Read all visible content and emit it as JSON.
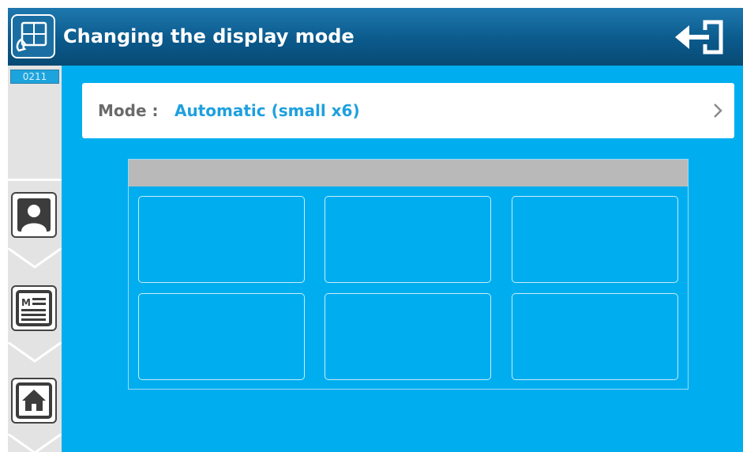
{
  "header": {
    "title": "Changing the display mode",
    "app_icon": "intercom-panel-icon",
    "exit_icon": "exit-icon",
    "color": "#0b5a8c"
  },
  "sidebar": {
    "code_badge": "0211",
    "buttons": [
      {
        "icon": "contact-icon"
      },
      {
        "icon": "message-icon"
      },
      {
        "icon": "home-icon"
      }
    ]
  },
  "mode": {
    "label": "Mode :",
    "value": "Automatic (small x6)",
    "chevron_icon": "chevron-right-icon",
    "accent": "#1ea0de"
  },
  "preview": {
    "layout": "small x6",
    "rows": 2,
    "columns": 3,
    "background": "#00aeef"
  }
}
